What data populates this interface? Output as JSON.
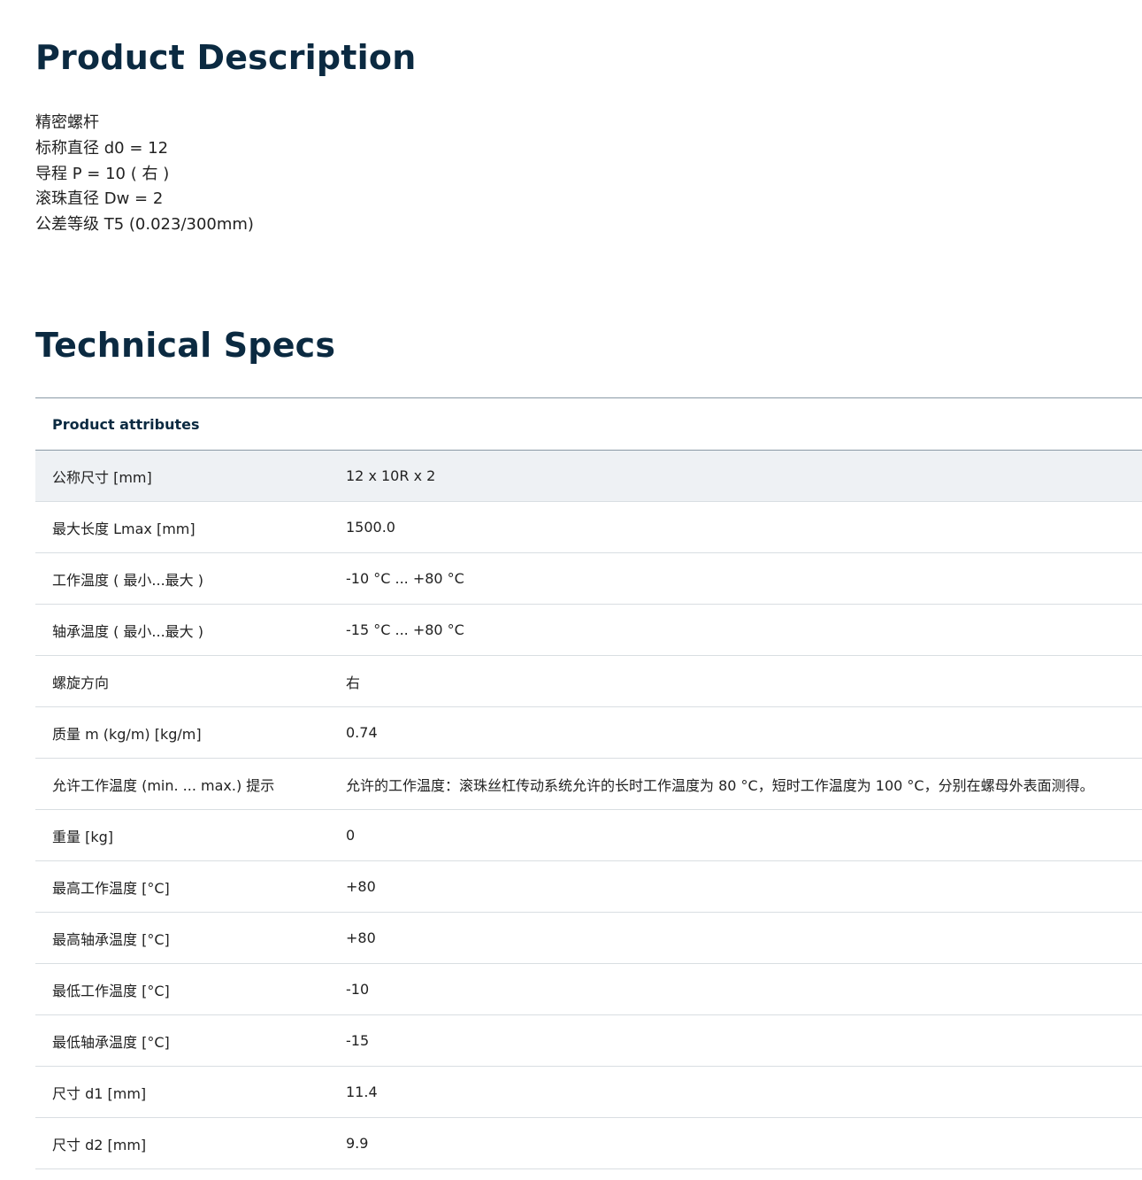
{
  "product_description": {
    "title": "Product Description",
    "lines": [
      "精密螺杆",
      "标称直径 d0 = 12",
      "导程 P = 10 ( 右 )",
      "滚珠直径 Dw = 2",
      "公差等级 T5 (0.023/300mm)"
    ]
  },
  "technical_specs": {
    "title": "Technical Specs",
    "table_header": "Product attributes",
    "rows": [
      {
        "attribute": "公称尺寸 [mm]",
        "value": "12 x 10R x 2"
      },
      {
        "attribute": "最大长度 Lmax [mm]",
        "value": "1500.0"
      },
      {
        "attribute": "工作温度 ( 最小...最大 )",
        "value": "-10 °C ... +80 °C"
      },
      {
        "attribute": "轴承温度 ( 最小...最大 )",
        "value": "-15 °C ... +80 °C"
      },
      {
        "attribute": "螺旋方向",
        "value": "右"
      },
      {
        "attribute": "质量 m (kg/m) [kg/m]",
        "value": "0.74"
      },
      {
        "attribute": "允许工作温度 (min. ... max.) 提示",
        "value": "允许的工作温度：滚珠丝杠传动系统允许的长时工作温度为 80 °C，短时工作温度为 100 °C，分别在螺母外表面测得。"
      },
      {
        "attribute": "重量 [kg]",
        "value": "0"
      },
      {
        "attribute": "最高工作温度 [°C]",
        "value": "+80"
      },
      {
        "attribute": "最高轴承温度 [°C]",
        "value": "+80"
      },
      {
        "attribute": "最低工作温度 [°C]",
        "value": "-10"
      },
      {
        "attribute": "最低轴承温度 [°C]",
        "value": "-15"
      },
      {
        "attribute": "尺寸 d1 [mm]",
        "value": "11.4"
      },
      {
        "attribute": "尺寸 d2 [mm]",
        "value": "9.9"
      }
    ]
  }
}
